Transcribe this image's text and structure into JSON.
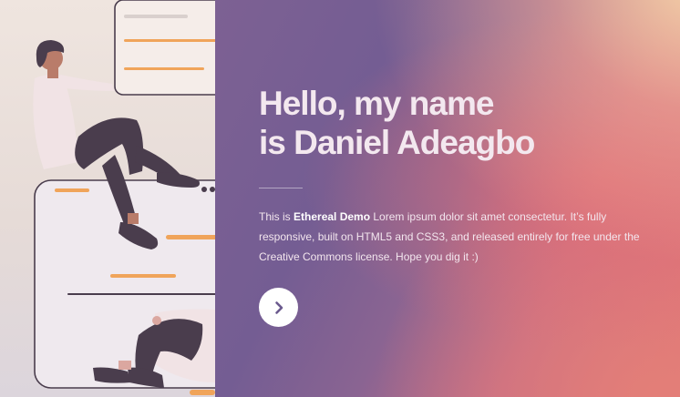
{
  "hero": {
    "heading_line1": "Hello, my name",
    "heading_line2": "is Daniel Adeagbo",
    "intro_prefix": "This is ",
    "intro_brand": "Ethereal Demo",
    "intro_rest": " Lorem ipsum dolor sit amet consectetur. It’s fully responsive, built on HTML5 and CSS3, and released entirely for free under the Creative Commons license. Hope you dig it :)",
    "next_icon": "chevron-right-icon"
  },
  "colors": {
    "heading": "#f3e8ef",
    "button_bg": "#ffffff",
    "button_icon": "#6b5a8e",
    "accent_orange": "#f0a45a",
    "figure_dark": "#4a3d4d"
  }
}
